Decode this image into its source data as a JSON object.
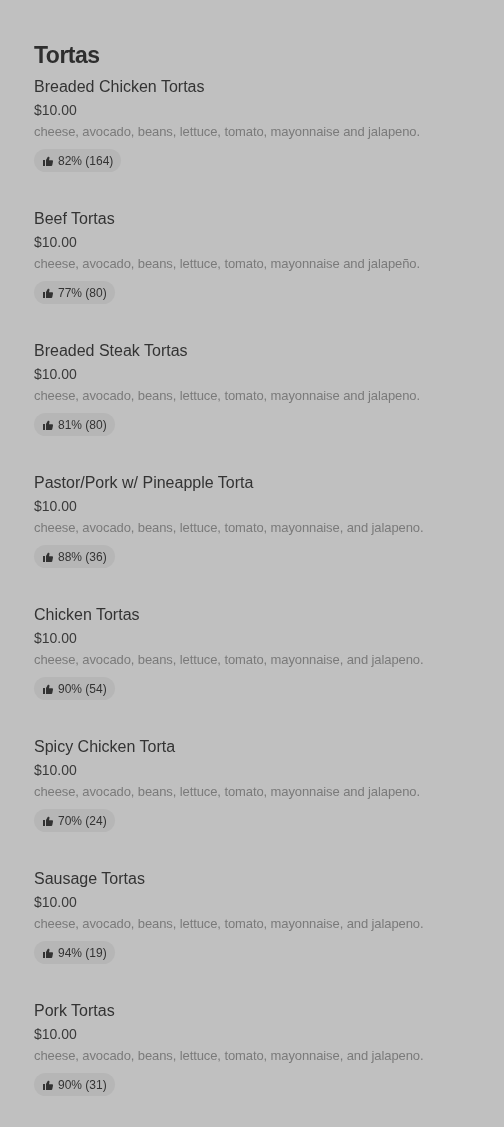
{
  "section_title": "Tortas",
  "items": [
    {
      "name": "Breaded Chicken Tortas",
      "price": "$10.00",
      "description": "cheese, avocado, beans, lettuce, tomato, mayonnaise and jalapeno.",
      "rating": "82% (164)"
    },
    {
      "name": "Beef Tortas",
      "price": "$10.00",
      "description": "cheese, avocado, beans, lettuce, tomato, mayonnaise and jalapeño.",
      "rating": "77% (80)"
    },
    {
      "name": "Breaded Steak Tortas",
      "price": "$10.00",
      "description": "cheese, avocado, beans, lettuce, tomato, mayonnaise and jalapeno.",
      "rating": "81% (80)"
    },
    {
      "name": "Pastor/Pork w/ Pineapple Torta",
      "price": "$10.00",
      "description": "cheese, avocado, beans, lettuce, tomato, mayonnaise, and jalapeno.",
      "rating": "88% (36)"
    },
    {
      "name": "Chicken Tortas",
      "price": "$10.00",
      "description": "cheese, avocado, beans, lettuce, tomato, mayonnaise, and jalapeno.",
      "rating": "90% (54)"
    },
    {
      "name": "Spicy Chicken Torta",
      "price": "$10.00",
      "description": "cheese, avocado, beans, lettuce, tomato, mayonnaise and jalapeno.",
      "rating": "70% (24)"
    },
    {
      "name": "Sausage Tortas",
      "price": "$10.00",
      "description": "cheese, avocado, beans, lettuce, tomato, mayonnaise, and jalapeno.",
      "rating": "94% (19)"
    },
    {
      "name": "Pork Tortas",
      "price": "$10.00",
      "description": "cheese, avocado, beans, lettuce, tomato, mayonnaise, and jalapeno.",
      "rating": "90% (31)"
    }
  ]
}
